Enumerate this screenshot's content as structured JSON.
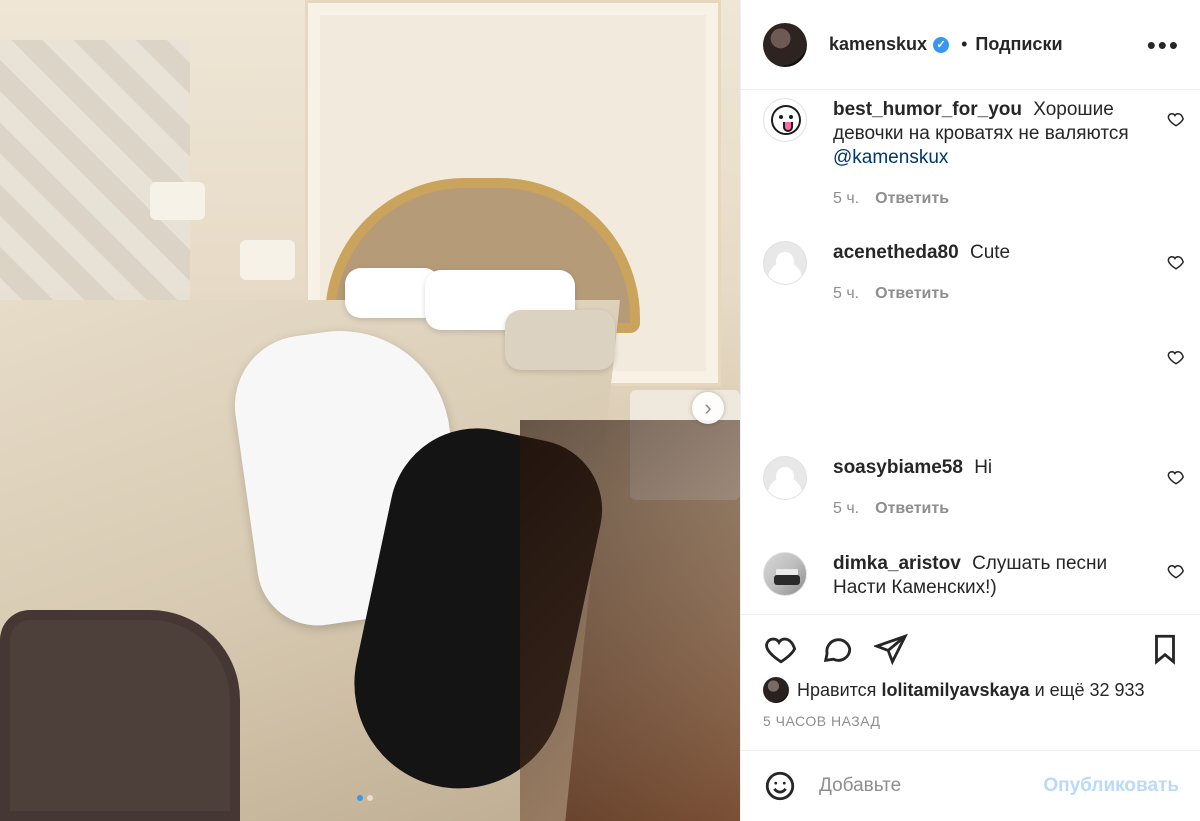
{
  "post": {
    "author": {
      "username": "kamenskux",
      "verified_icon": "verified-badge-icon",
      "separator": "•",
      "follow_label": "Подписки"
    },
    "more_icon": "more-horizontal-icon",
    "media": {
      "next_icon": "chevron-right-icon",
      "next_glyph": "›",
      "carousel_active_index": 1,
      "carousel_count": 2
    },
    "comments": [
      {
        "avatar_icon": "smiley-avatar-icon",
        "username": "best_humor_for_you",
        "text": "Хорошие девочки на кроватях не валяются",
        "mention": "@kamenskux",
        "time": "5 ч.",
        "reply_label": "Ответить",
        "like_icon": "heart-outline-icon"
      },
      {
        "avatar_icon": "default-avatar-icon",
        "username": "acenetheda80",
        "text": "Cute",
        "time": "5 ч.",
        "reply_label": "Ответить",
        "like_icon": "heart-outline-icon"
      },
      {
        "avatar_icon": "hidden-avatar-icon",
        "username": "",
        "text": "",
        "like_icon": "heart-outline-icon"
      },
      {
        "avatar_icon": "default-avatar-icon",
        "username": "soasybiame58",
        "text": "Hi",
        "time": "5 ч.",
        "reply_label": "Ответить",
        "like_icon": "heart-outline-icon"
      },
      {
        "avatar_icon": "photo-avatar-icon",
        "username": "dimka_aristov",
        "text": "Слушать песни Насти Каменских!)",
        "like_icon": "heart-outline-icon"
      }
    ],
    "actions": {
      "like_icon": "heart-outline-icon",
      "comment_icon": "comment-bubble-icon",
      "share_icon": "send-plane-icon",
      "save_icon": "bookmark-icon"
    },
    "likes": {
      "prefix": "Нравится",
      "user": "lolitamilyavskaya",
      "suffix": "и ещё 32 933"
    },
    "posted_ago": "5 ЧАСОВ НАЗАД",
    "add_comment": {
      "emoji_icon": "emoji-smile-icon",
      "placeholder": "Добавьте",
      "publish_label": "Опубликовать"
    }
  },
  "colors": {
    "text": "#262626",
    "muted": "#8e8e8e",
    "link": "#00376b",
    "accent": "#3897f0",
    "border": "#efefef"
  }
}
